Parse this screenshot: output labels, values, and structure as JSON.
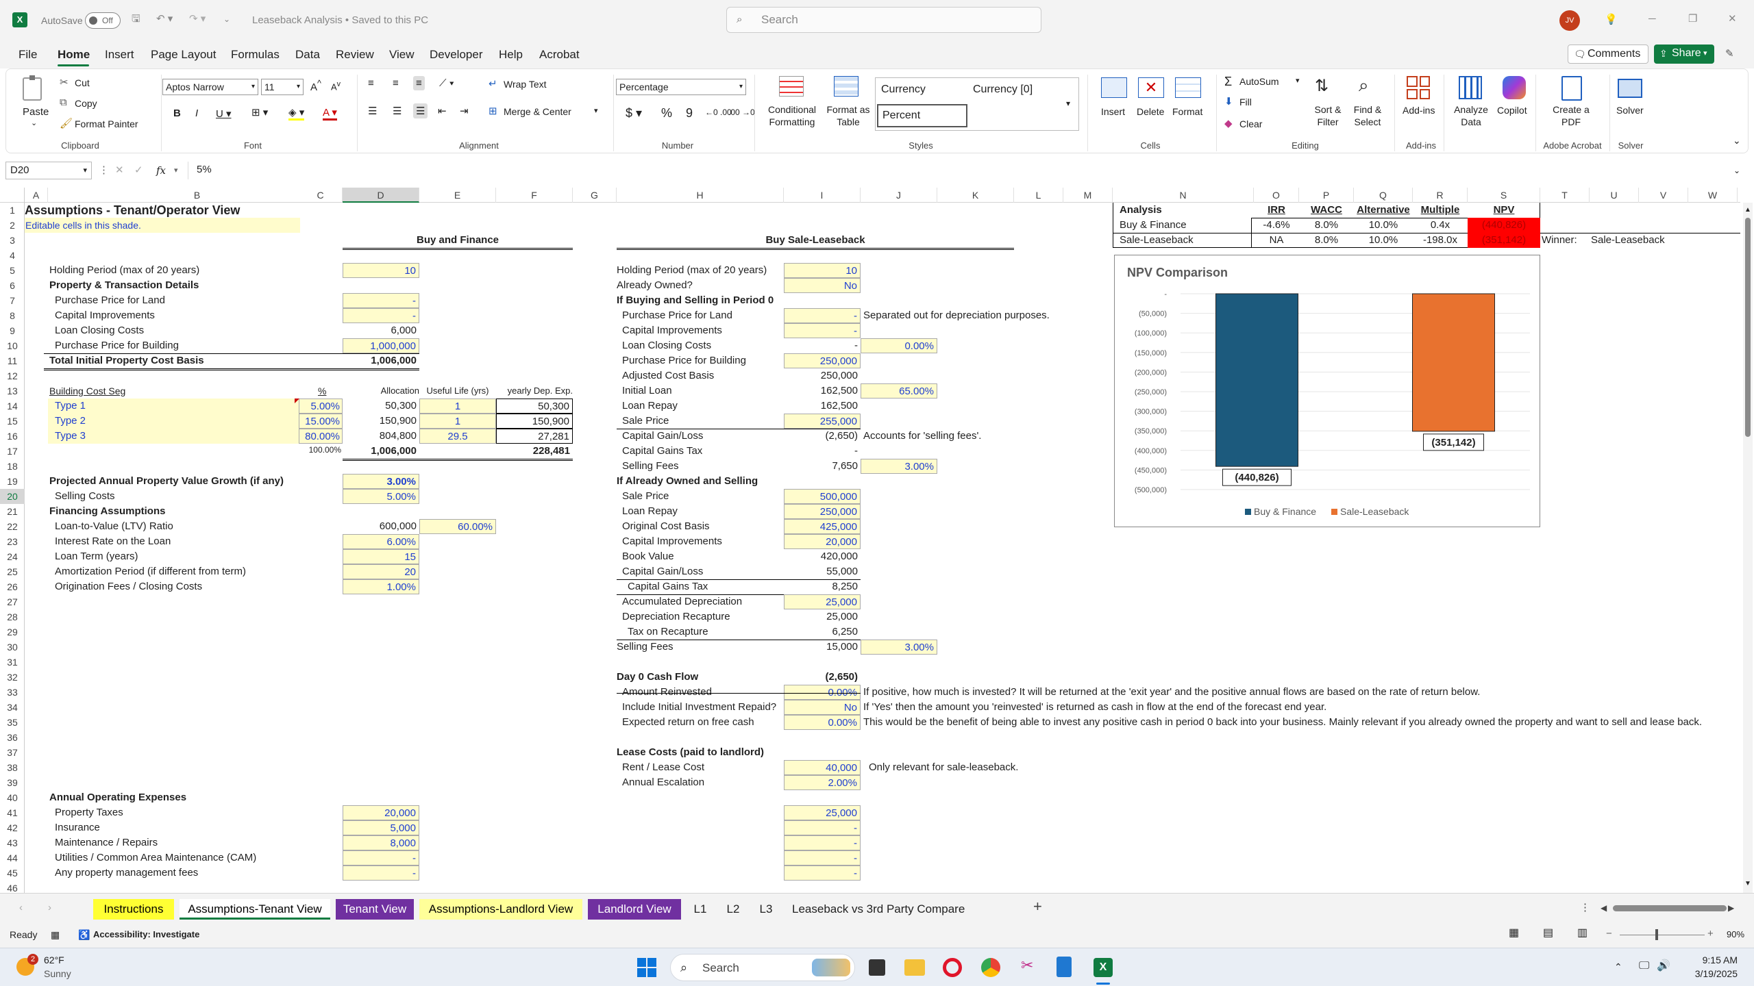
{
  "app": {
    "autosave": "AutoSave",
    "autosave_state": "Off",
    "doc_title": "Leaseback Analysis • Saved to this PC",
    "search_placeholder": "Search",
    "user_initials": "JV"
  },
  "menu": [
    "File",
    "Home",
    "Insert",
    "Page Layout",
    "Formulas",
    "Data",
    "Review",
    "View",
    "Developer",
    "Help",
    "Acrobat"
  ],
  "menu_right": {
    "comments": "Comments",
    "share": "Share"
  },
  "ribbon": {
    "clipboard": {
      "paste": "Paste",
      "cut": "Cut",
      "copy": "Copy",
      "painter": "Format Painter",
      "label": "Clipboard"
    },
    "font": {
      "name": "Aptos Narrow",
      "size": "11",
      "label": "Font"
    },
    "alignment": {
      "wrap": "Wrap Text",
      "merge": "Merge & Center",
      "label": "Alignment"
    },
    "number": {
      "format": "Percentage",
      "label": "Number"
    },
    "styles": {
      "cond": "Conditional Formatting",
      "table": "Format as Table",
      "s1": "Currency",
      "s2": "Currency [0]",
      "s3": "Percent",
      "label": "Styles"
    },
    "cells": {
      "insert": "Insert",
      "delete": "Delete",
      "format": "Format",
      "label": "Cells"
    },
    "editing": {
      "autosum": "AutoSum",
      "fill": "Fill",
      "clear": "Clear",
      "sort": "Sort & Filter",
      "find": "Find & Select",
      "label": "Editing"
    },
    "addins": {
      "addins": "Add-ins",
      "label": "Add-ins"
    },
    "misc": {
      "analyze": "Analyze Data",
      "copilot": "Copilot",
      "pdf": "Create a PDF",
      "acrobat_label": "Adobe Acrobat",
      "solver": "Solver",
      "solver_label": "Solver"
    }
  },
  "formula_bar": {
    "cell_ref": "D20",
    "fx": "fx",
    "value": "5%"
  },
  "columns": [
    "A",
    "B",
    "C",
    "D",
    "E",
    "F",
    "G",
    "H",
    "I",
    "J",
    "K",
    "L",
    "M",
    "N",
    "O",
    "P",
    "Q",
    "R",
    "S",
    "T",
    "U",
    "V",
    "W"
  ],
  "rows": [
    "1",
    "2",
    "3",
    "4",
    "5",
    "6",
    "7",
    "8",
    "9",
    "10",
    "11",
    "12",
    "13",
    "14",
    "15",
    "16",
    "17",
    "18",
    "19",
    "20",
    "21",
    "22",
    "23",
    "24",
    "25",
    "26",
    "27",
    "28",
    "29",
    "30",
    "31",
    "32",
    "33",
    "34",
    "35",
    "36",
    "37",
    "38",
    "39",
    "40",
    "41",
    "42",
    "43",
    "44",
    "45",
    "46"
  ],
  "sheet": {
    "title": "Assumptions - Tenant/Operator View",
    "editable": "Editable cells in this shade.",
    "buy_finance": "Buy and Finance",
    "sale_leaseback": "Buy Sale-Leaseback",
    "left": [
      {
        "r": 5,
        "label": "Holding Period (max of 20 years)",
        "val": "10"
      },
      {
        "r": 6,
        "label": "Property & Transaction Details",
        "bold": true
      },
      {
        "r": 7,
        "label": "Purchase Price for Land",
        "val": "-",
        "ind": 1
      },
      {
        "r": 8,
        "label": "Capital Improvements",
        "val": "-",
        "ind": 1
      },
      {
        "r": 9,
        "label": "Loan Closing Costs",
        "val": "6,000",
        "ind": 1,
        "plain": true
      },
      {
        "r": 10,
        "label": "Purchase Price for Building",
        "val": "1,000,000",
        "ind": 1
      },
      {
        "r": 11,
        "label": "Total Initial Property Cost Basis",
        "val": "1,006,000",
        "bold": true,
        "plain": true
      },
      {
        "r": 19,
        "label": "Projected Annual Property Value Growth (if any)",
        "val": "3.00%",
        "bold": true
      },
      {
        "r": 20,
        "label": "Selling Costs",
        "val": "5.00%",
        "ind": 1
      },
      {
        "r": 21,
        "label": "Financing Assumptions",
        "bold": true
      },
      {
        "r": 22,
        "label": "Loan-to-Value (LTV) Ratio",
        "val": "600,000",
        "ind": 1,
        "plain": true,
        "e": "60.00%"
      },
      {
        "r": 23,
        "label": "Interest Rate on the Loan",
        "val": "6.00%",
        "ind": 1
      },
      {
        "r": 24,
        "label": "Loan Term (years)",
        "val": "15",
        "ind": 1
      },
      {
        "r": 25,
        "label": "Amortization Period (if different from term)",
        "val": "20",
        "ind": 1
      },
      {
        "r": 26,
        "label": "Origination Fees / Closing Costs",
        "val": "1.00%",
        "ind": 1
      },
      {
        "r": 40,
        "label": "Annual Operating Expenses",
        "bold": true
      },
      {
        "r": 41,
        "label": "Property Taxes",
        "val": "20,000",
        "ind": 1,
        "i": "25,000"
      },
      {
        "r": 42,
        "label": "Insurance",
        "val": "5,000",
        "ind": 1,
        "i": "-"
      },
      {
        "r": 43,
        "label": "Maintenance / Repairs",
        "val": "8,000",
        "ind": 1,
        "i": "-"
      },
      {
        "r": 44,
        "label": "Utilities / Common Area Maintenance (CAM)",
        "val": "-",
        "ind": 1,
        "i": "-"
      },
      {
        "r": 45,
        "label": "Any property management fees",
        "val": "-",
        "ind": 1,
        "i": "-"
      }
    ],
    "costseg": {
      "header": "Building Cost Seg",
      "pct": "%",
      "alloc": "Allocation",
      "life": "Useful Life (yrs)",
      "dep": "yearly Dep. Exp.",
      "rows": [
        {
          "name": "Type 1",
          "pct": "5.00%",
          "alloc": "50,300",
          "life": "1",
          "dep": "50,300"
        },
        {
          "name": "Type 2",
          "pct": "15.00%",
          "alloc": "150,900",
          "life": "1",
          "dep": "150,900"
        },
        {
          "name": "Type 3",
          "pct": "80.00%",
          "alloc": "804,800",
          "life": "29.5",
          "dep": "27,281"
        }
      ],
      "total_pct": "100.00%",
      "total_alloc": "1,006,000",
      "total_dep": "228,481"
    },
    "right": [
      {
        "r": 5,
        "label": "Holding Period (max of 20 years)",
        "val": "10",
        "y": 1
      },
      {
        "r": 6,
        "label": "Already Owned?",
        "val": "No",
        "y": 1
      },
      {
        "r": 7,
        "label": "If Buying and Selling in Period 0",
        "bold": true
      },
      {
        "r": 8,
        "label": "Purchase Price for Land",
        "val": "-",
        "y": 1,
        "ind": 1,
        "note": "Separated out for depreciation purposes."
      },
      {
        "r": 9,
        "label": "Capital Improvements",
        "val": "-",
        "y": 1,
        "ind": 1
      },
      {
        "r": 10,
        "label": "Loan Closing Costs",
        "val": "-",
        "ind": 1,
        "j": "0.00%"
      },
      {
        "r": 11,
        "label": "Purchase Price for Building",
        "val": "250,000",
        "y": 1,
        "ind": 1
      },
      {
        "r": 12,
        "label": "Adjusted Cost Basis",
        "val": "250,000",
        "ind": 1
      },
      {
        "r": 13,
        "label": "Initial Loan",
        "val": "162,500",
        "ind": 1,
        "j": "65.00%"
      },
      {
        "r": 14,
        "label": "Loan Repay",
        "val": "162,500",
        "ind": 1
      },
      {
        "r": 15,
        "label": "Sale Price",
        "val": "255,000",
        "y": 1,
        "ind": 1
      },
      {
        "r": 16,
        "label": "Capital Gain/Loss",
        "val": "(2,650)",
        "ind": 1,
        "note": "Accounts for 'selling fees'."
      },
      {
        "r": 17,
        "label": "Capital Gains Tax",
        "val": "-",
        "ind": 1
      },
      {
        "r": 18,
        "label": "Selling Fees",
        "val": "7,650",
        "ind": 1,
        "j": "3.00%"
      },
      {
        "r": 19,
        "label": "If Already Owned and Selling",
        "bold": true
      },
      {
        "r": 20,
        "label": "Sale Price",
        "val": "500,000",
        "y": 1,
        "ind": 1
      },
      {
        "r": 21,
        "label": "Loan Repay",
        "val": "250,000",
        "y": 1,
        "ind": 1
      },
      {
        "r": 22,
        "label": "Original Cost Basis",
        "val": "425,000",
        "y": 1,
        "ind": 1
      },
      {
        "r": 23,
        "label": "Capital Improvements",
        "val": "20,000",
        "y": 1,
        "ind": 1
      },
      {
        "r": 24,
        "label": "Book Value",
        "val": "420,000",
        "ind": 1
      },
      {
        "r": 25,
        "label": "Capital Gain/Loss",
        "val": "55,000",
        "ind": 1
      },
      {
        "r": 26,
        "label": "Capital Gains Tax",
        "val": "8,250",
        "ind": 2
      },
      {
        "r": 27,
        "label": "Accumulated Depreciation",
        "val": "25,000",
        "y": 1,
        "ind": 1
      },
      {
        "r": 28,
        "label": "Depreciation Recapture",
        "val": "25,000",
        "ind": 1
      },
      {
        "r": 29,
        "label": "Tax on Recapture",
        "val": "6,250",
        "ind": 2
      },
      {
        "r": 30,
        "label": "Selling Fees",
        "val": "15,000",
        "j": "3.00%"
      },
      {
        "r": 32,
        "label": "Day 0 Cash Flow",
        "val": "(2,650)",
        "bold": true
      },
      {
        "r": 33,
        "label": "Amount Reinvested",
        "val": "0.00%",
        "y": 1,
        "ind": 1,
        "note": "If positive, how much is invested? It will be returned at the 'exit year' and the positive annual flows are based on the rate of return below."
      },
      {
        "r": 34,
        "label": "Include Initial Investment Repaid?",
        "val": "No",
        "y": 1,
        "ind": 1,
        "note": "If 'Yes' then the amount you 'reinvested' is returned as cash in flow at the end of the forecast end year."
      },
      {
        "r": 35,
        "label": "Expected return on free cash",
        "val": "0.00%",
        "y": 1,
        "ind": 1,
        "note": "This would be the benefit of being able to invest any positive cash in period 0 back into your business. Mainly relevant if you already owned the property and want to sell and lease back."
      },
      {
        "r": 37,
        "label": "Lease Costs (paid to landlord)",
        "bold": true
      },
      {
        "r": 38,
        "label": "Rent / Lease Cost",
        "val": "40,000",
        "y": 1,
        "ind": 1,
        "note": "Only relevant for sale-leaseback."
      },
      {
        "r": 39,
        "label": "Annual Escalation",
        "val": "2.00%",
        "y": 1,
        "ind": 1
      }
    ],
    "analysis": {
      "title": "Analysis",
      "headers": [
        "IRR",
        "WACC",
        "Alternative",
        "Multiple",
        "NPV"
      ],
      "rows": [
        {
          "name": "Buy & Finance",
          "irr": "-4.6%",
          "wacc": "8.0%",
          "alt": "10.0%",
          "mult": "0.4x",
          "npv": "(440,826)"
        },
        {
          "name": "Sale-Leaseback",
          "irr": "NA",
          "wacc": "8.0%",
          "alt": "10.0%",
          "mult": "-198.0x",
          "npv": "(351,142)"
        }
      ],
      "winner_label": "Winner:",
      "winner": "Sale-Leaseback"
    }
  },
  "chart_data": {
    "type": "bar",
    "title": "NPV Comparison",
    "categories": [
      "Buy & Finance",
      "Sale-Leaseback"
    ],
    "values": [
      -440826,
      -351142
    ],
    "data_labels": [
      "(440,826)",
      "(351,142)"
    ],
    "ylim": [
      -500000,
      0
    ],
    "yticks": [
      "-",
      "(50,000)",
      "(100,000)",
      "(150,000)",
      "(200,000)",
      "(250,000)",
      "(300,000)",
      "(350,000)",
      "(400,000)",
      "(450,000)",
      "(500,000)"
    ],
    "colors": [
      "#1c5a7d",
      "#e8722f"
    ],
    "legend": "bottom",
    "grid": true
  },
  "tabs": [
    {
      "name": "Instructions",
      "bg": "#ffff33",
      "fg": "#000"
    },
    {
      "name": "Assumptions-Tenant View",
      "bg": "#ffffff",
      "fg": "#000",
      "active": true
    },
    {
      "name": "Tenant View",
      "bg": "#7030a0",
      "fg": "#fff"
    },
    {
      "name": "Assumptions-Landlord View",
      "bg": "#ffff99",
      "fg": "#000"
    },
    {
      "name": "Landlord View",
      "bg": "#7030a0",
      "fg": "#fff"
    },
    {
      "name": "L1",
      "bg": "",
      "fg": "#222"
    },
    {
      "name": "L2",
      "bg": "",
      "fg": "#222"
    },
    {
      "name": "L3",
      "bg": "",
      "fg": "#222"
    },
    {
      "name": "Leaseback vs 3rd Party Compare",
      "bg": "",
      "fg": "#222"
    }
  ],
  "status": {
    "ready": "Ready",
    "accessibility": "Accessibility: Investigate",
    "zoom": "90%"
  },
  "taskbar": {
    "temp": "62°F",
    "weather": "Sunny",
    "badge": "2",
    "search": "Search",
    "time": "9:15 AM",
    "date": "3/19/2025"
  }
}
